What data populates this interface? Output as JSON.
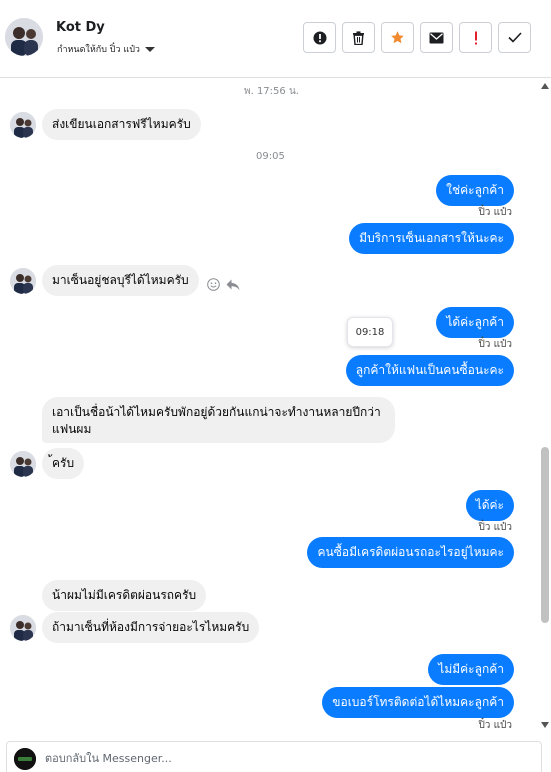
{
  "header": {
    "contact_name": "Kot Dy",
    "assign_label": "กำหนดให้กับ ปิ๋ว แป๋ว",
    "actions": [
      {
        "name": "spam-icon",
        "color": "#1c1e21"
      },
      {
        "name": "trash-icon",
        "color": "#1c1e21"
      },
      {
        "name": "star-icon",
        "color": "#f28b2f"
      },
      {
        "name": "mail-icon",
        "color": "#1c1e21"
      },
      {
        "name": "exclamation-icon",
        "color": "#e4202e"
      },
      {
        "name": "check-icon",
        "color": "#1c1e21"
      }
    ]
  },
  "colors": {
    "outgoing": "#0a7cff",
    "incoming": "#f0f0f0",
    "timestamp": "#8a8d91"
  },
  "chat": {
    "time_1": "พ. 17:56 น.",
    "time_2": "09:05",
    "tooltip_time": "09:18",
    "seen_label": "ปิ๋ว แป๋ว",
    "messages": [
      {
        "dir": "in",
        "text": "ส่งเขียนเอกสารฟรีไหมครับ"
      },
      {
        "dir": "out",
        "text": "ใช่ค่ะลูกค้า"
      },
      {
        "dir": "out",
        "text": "มีบริการเซ็นเอกสารให้นะคะ"
      },
      {
        "dir": "in",
        "text": "มาเซ็นอยู่ชลบุรีได้ไหมครับ"
      },
      {
        "dir": "out",
        "text": "ได้ค่ะลูกค้า"
      },
      {
        "dir": "out",
        "text": "ลูกค้าให้แฟนเป็นคนซื้อนะคะ"
      },
      {
        "dir": "in",
        "text": "เอาเป็นชื่อน้าได้ไหมครับพักอยู่ด้วยกันแกน่าจะทำงานหลายปีกว่า"
      },
      {
        "dir": "in",
        "text": "แฟนผม"
      },
      {
        "dir": "in",
        "text": "้ครับ"
      },
      {
        "dir": "out",
        "text": "ได้ค่ะ"
      },
      {
        "dir": "out",
        "text": "คนซื้อมีเครดิตผ่อนรถอะไรอยู่ไหมคะ"
      },
      {
        "dir": "in",
        "text": "น้าผมไม่มีเครดิตผ่อนรถครับ"
      },
      {
        "dir": "in",
        "text": "ถ้ามาเซ็นที่ห้องมีการจ่ายอะไรไหมครับ"
      },
      {
        "dir": "out",
        "text": "ไม่มีค่ะลูกค้า"
      },
      {
        "dir": "out",
        "text": "ขอเบอร์โทรติดต่อได้ไหมคะลูกค้า"
      }
    ]
  },
  "composer": {
    "placeholder": "ตอบกลับใน Messenger..."
  }
}
